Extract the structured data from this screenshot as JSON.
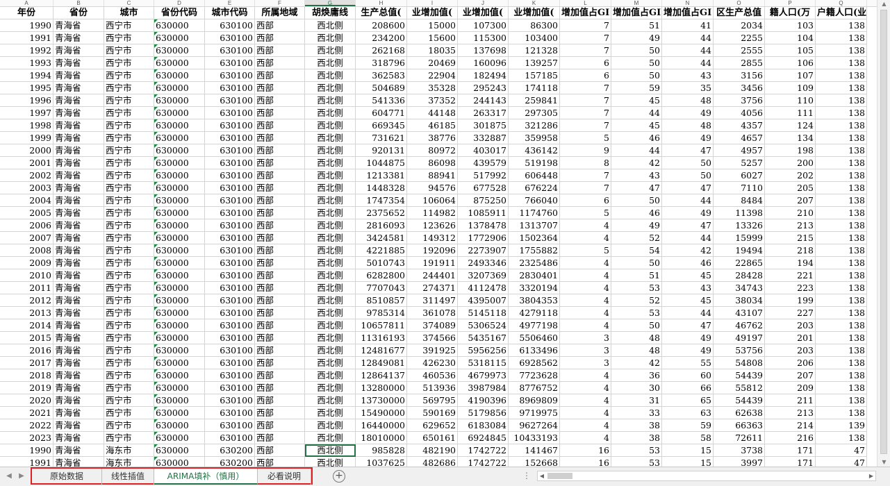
{
  "sheet": {
    "columns": [
      "A",
      "B",
      "C",
      "D",
      "E",
      "F",
      "G",
      "H",
      "I",
      "J",
      "K",
      "L",
      "M",
      "N",
      "O",
      "P",
      "Q"
    ],
    "selected_column": "G",
    "headers": [
      "年份",
      "省份",
      "城市",
      "省份代码",
      "城市代码",
      "所属地域",
      "胡焕庸线",
      "生产总值(",
      "业增加值(",
      "业增加值(",
      "业增加值(",
      "增加值占GI",
      "增加值占GI",
      "增加值占GI",
      "区生产总值",
      "籍人口(万",
      "户籍人口(业"
    ],
    "rows": [
      [
        "1990",
        "青海省",
        "西宁市",
        "630000",
        "630100",
        "西部",
        "西北侧",
        "208600",
        "15000",
        "107300",
        "86300",
        "7",
        "51",
        "41",
        "2034",
        "103",
        "138"
      ],
      [
        "1991",
        "青海省",
        "西宁市",
        "630000",
        "630100",
        "西部",
        "西北侧",
        "234200",
        "15600",
        "115300",
        "103400",
        "7",
        "49",
        "44",
        "2255",
        "104",
        "138"
      ],
      [
        "1992",
        "青海省",
        "西宁市",
        "630000",
        "630100",
        "西部",
        "西北侧",
        "262168",
        "18035",
        "137698",
        "121328",
        "7",
        "50",
        "44",
        "2555",
        "105",
        "138"
      ],
      [
        "1993",
        "青海省",
        "西宁市",
        "630000",
        "630100",
        "西部",
        "西北侧",
        "318796",
        "20469",
        "160096",
        "139257",
        "6",
        "50",
        "44",
        "2855",
        "106",
        "138"
      ],
      [
        "1994",
        "青海省",
        "西宁市",
        "630000",
        "630100",
        "西部",
        "西北侧",
        "362583",
        "22904",
        "182494",
        "157185",
        "6",
        "50",
        "43",
        "3156",
        "107",
        "138"
      ],
      [
        "1995",
        "青海省",
        "西宁市",
        "630000",
        "630100",
        "西部",
        "西北侧",
        "504689",
        "35328",
        "295243",
        "174118",
        "7",
        "59",
        "35",
        "3456",
        "109",
        "138"
      ],
      [
        "1996",
        "青海省",
        "西宁市",
        "630000",
        "630100",
        "西部",
        "西北侧",
        "541336",
        "37352",
        "244143",
        "259841",
        "7",
        "45",
        "48",
        "3756",
        "110",
        "138"
      ],
      [
        "1997",
        "青海省",
        "西宁市",
        "630000",
        "630100",
        "西部",
        "西北侧",
        "604771",
        "44148",
        "263317",
        "297305",
        "7",
        "44",
        "49",
        "4056",
        "111",
        "138"
      ],
      [
        "1998",
        "青海省",
        "西宁市",
        "630000",
        "630100",
        "西部",
        "西北侧",
        "669345",
        "46185",
        "301875",
        "321286",
        "7",
        "45",
        "48",
        "4357",
        "124",
        "138"
      ],
      [
        "1999",
        "青海省",
        "西宁市",
        "630000",
        "630100",
        "西部",
        "西北侧",
        "731621",
        "38776",
        "332887",
        "359958",
        "5",
        "46",
        "49",
        "4657",
        "134",
        "138"
      ],
      [
        "2000",
        "青海省",
        "西宁市",
        "630000",
        "630100",
        "西部",
        "西北侧",
        "920131",
        "80972",
        "403017",
        "436142",
        "9",
        "44",
        "47",
        "4957",
        "198",
        "138"
      ],
      [
        "2001",
        "青海省",
        "西宁市",
        "630000",
        "630100",
        "西部",
        "西北侧",
        "1044875",
        "86098",
        "439579",
        "519198",
        "8",
        "42",
        "50",
        "5257",
        "200",
        "138"
      ],
      [
        "2002",
        "青海省",
        "西宁市",
        "630000",
        "630100",
        "西部",
        "西北侧",
        "1213381",
        "88941",
        "517992",
        "606448",
        "7",
        "43",
        "50",
        "6027",
        "202",
        "138"
      ],
      [
        "2003",
        "青海省",
        "西宁市",
        "630000",
        "630100",
        "西部",
        "西北侧",
        "1448328",
        "94576",
        "677528",
        "676224",
        "7",
        "47",
        "47",
        "7110",
        "205",
        "138"
      ],
      [
        "2004",
        "青海省",
        "西宁市",
        "630000",
        "630100",
        "西部",
        "西北侧",
        "1747354",
        "106064",
        "875250",
        "766040",
        "6",
        "50",
        "44",
        "8484",
        "207",
        "138"
      ],
      [
        "2005",
        "青海省",
        "西宁市",
        "630000",
        "630100",
        "西部",
        "西北侧",
        "2375652",
        "114982",
        "1085911",
        "1174760",
        "5",
        "46",
        "49",
        "11398",
        "210",
        "138"
      ],
      [
        "2006",
        "青海省",
        "西宁市",
        "630000",
        "630100",
        "西部",
        "西北侧",
        "2816093",
        "123626",
        "1378478",
        "1313707",
        "4",
        "49",
        "47",
        "13326",
        "213",
        "138"
      ],
      [
        "2007",
        "青海省",
        "西宁市",
        "630000",
        "630100",
        "西部",
        "西北侧",
        "3424581",
        "149312",
        "1772906",
        "1502364",
        "4",
        "52",
        "44",
        "15999",
        "215",
        "138"
      ],
      [
        "2008",
        "青海省",
        "西宁市",
        "630000",
        "630100",
        "西部",
        "西北侧",
        "4221885",
        "192096",
        "2273907",
        "1755882",
        "5",
        "54",
        "42",
        "19494",
        "218",
        "138"
      ],
      [
        "2009",
        "青海省",
        "西宁市",
        "630000",
        "630100",
        "西部",
        "西北侧",
        "5010743",
        "191911",
        "2493346",
        "2325486",
        "4",
        "50",
        "46",
        "22865",
        "194",
        "138"
      ],
      [
        "2010",
        "青海省",
        "西宁市",
        "630000",
        "630100",
        "西部",
        "西北侧",
        "6282800",
        "244401",
        "3207369",
        "2830401",
        "4",
        "51",
        "45",
        "28428",
        "221",
        "138"
      ],
      [
        "2011",
        "青海省",
        "西宁市",
        "630000",
        "630100",
        "西部",
        "西北侧",
        "7707043",
        "274371",
        "4112478",
        "3320194",
        "4",
        "53",
        "43",
        "34743",
        "223",
        "138"
      ],
      [
        "2012",
        "青海省",
        "西宁市",
        "630000",
        "630100",
        "西部",
        "西北侧",
        "8510857",
        "311497",
        "4395007",
        "3804353",
        "4",
        "52",
        "45",
        "38034",
        "199",
        "138"
      ],
      [
        "2013",
        "青海省",
        "西宁市",
        "630000",
        "630100",
        "西部",
        "西北侧",
        "9785314",
        "361078",
        "5145118",
        "4279118",
        "4",
        "53",
        "44",
        "43107",
        "227",
        "138"
      ],
      [
        "2014",
        "青海省",
        "西宁市",
        "630000",
        "630100",
        "西部",
        "西北侧",
        "10657811",
        "374089",
        "5306524",
        "4977198",
        "4",
        "50",
        "47",
        "46762",
        "203",
        "138"
      ],
      [
        "2015",
        "青海省",
        "西宁市",
        "630000",
        "630100",
        "西部",
        "西北侧",
        "11316193",
        "374566",
        "5435167",
        "5506460",
        "3",
        "48",
        "49",
        "49197",
        "201",
        "138"
      ],
      [
        "2016",
        "青海省",
        "西宁市",
        "630000",
        "630100",
        "西部",
        "西北侧",
        "12481677",
        "391925",
        "5956256",
        "6133496",
        "3",
        "48",
        "49",
        "53756",
        "203",
        "138"
      ],
      [
        "2017",
        "青海省",
        "西宁市",
        "630000",
        "630100",
        "西部",
        "西北侧",
        "12849081",
        "426230",
        "5318115",
        "6928562",
        "3",
        "42",
        "55",
        "54808",
        "206",
        "138"
      ],
      [
        "2018",
        "青海省",
        "西宁市",
        "630000",
        "630100",
        "西部",
        "西北侧",
        "12864137",
        "460536",
        "4679973",
        "7723628",
        "4",
        "36",
        "60",
        "54439",
        "207",
        "138"
      ],
      [
        "2019",
        "青海省",
        "西宁市",
        "630000",
        "630100",
        "西部",
        "西北侧",
        "13280000",
        "513936",
        "3987984",
        "8776752",
        "4",
        "30",
        "66",
        "55812",
        "209",
        "138"
      ],
      [
        "2020",
        "青海省",
        "西宁市",
        "630000",
        "630100",
        "西部",
        "西北侧",
        "13730000",
        "569795",
        "4190396",
        "8969809",
        "4",
        "31",
        "65",
        "54439",
        "211",
        "138"
      ],
      [
        "2021",
        "青海省",
        "西宁市",
        "630000",
        "630100",
        "西部",
        "西北侧",
        "15490000",
        "590169",
        "5179856",
        "9719975",
        "4",
        "33",
        "63",
        "62638",
        "213",
        "138"
      ],
      [
        "2022",
        "青海省",
        "西宁市",
        "630000",
        "630100",
        "西部",
        "西北侧",
        "16440000",
        "629652",
        "6183084",
        "9627264",
        "4",
        "38",
        "59",
        "66363",
        "214",
        "139"
      ],
      [
        "2023",
        "青海省",
        "西宁市",
        "630000",
        "630100",
        "西部",
        "西北侧",
        "18010000",
        "650161",
        "6924845",
        "10433193",
        "4",
        "38",
        "58",
        "72611",
        "216",
        "138"
      ],
      [
        "1990",
        "青海省",
        "海东市",
        "630000",
        "630200",
        "西部",
        "西北侧",
        "985828",
        "482190",
        "1742722",
        "141467",
        "16",
        "53",
        "15",
        "3738",
        "171",
        "47"
      ],
      [
        "1991",
        "青海省",
        "海东市",
        "630000",
        "630200",
        "西部",
        "西北侧",
        "1037625",
        "482686",
        "1742722",
        "152668",
        "16",
        "53",
        "15",
        "3997",
        "171",
        "47"
      ]
    ]
  },
  "tabs": [
    {
      "label": "原始数据",
      "active": false
    },
    {
      "label": "线性插值",
      "active": false
    },
    {
      "label": "ARIMA填补（慎用）",
      "active": true
    },
    {
      "label": "必看说明",
      "active": false
    }
  ],
  "icons": {
    "add_sheet": "plus-circle-icon",
    "tab_prev": "triangle-left-icon",
    "tab_next": "triangle-right-icon",
    "more": "ellipsis-icon"
  },
  "colors": {
    "accent": "#217346",
    "highlight_frame": "#e02020",
    "text_number_flag": "#1a8a3c"
  }
}
